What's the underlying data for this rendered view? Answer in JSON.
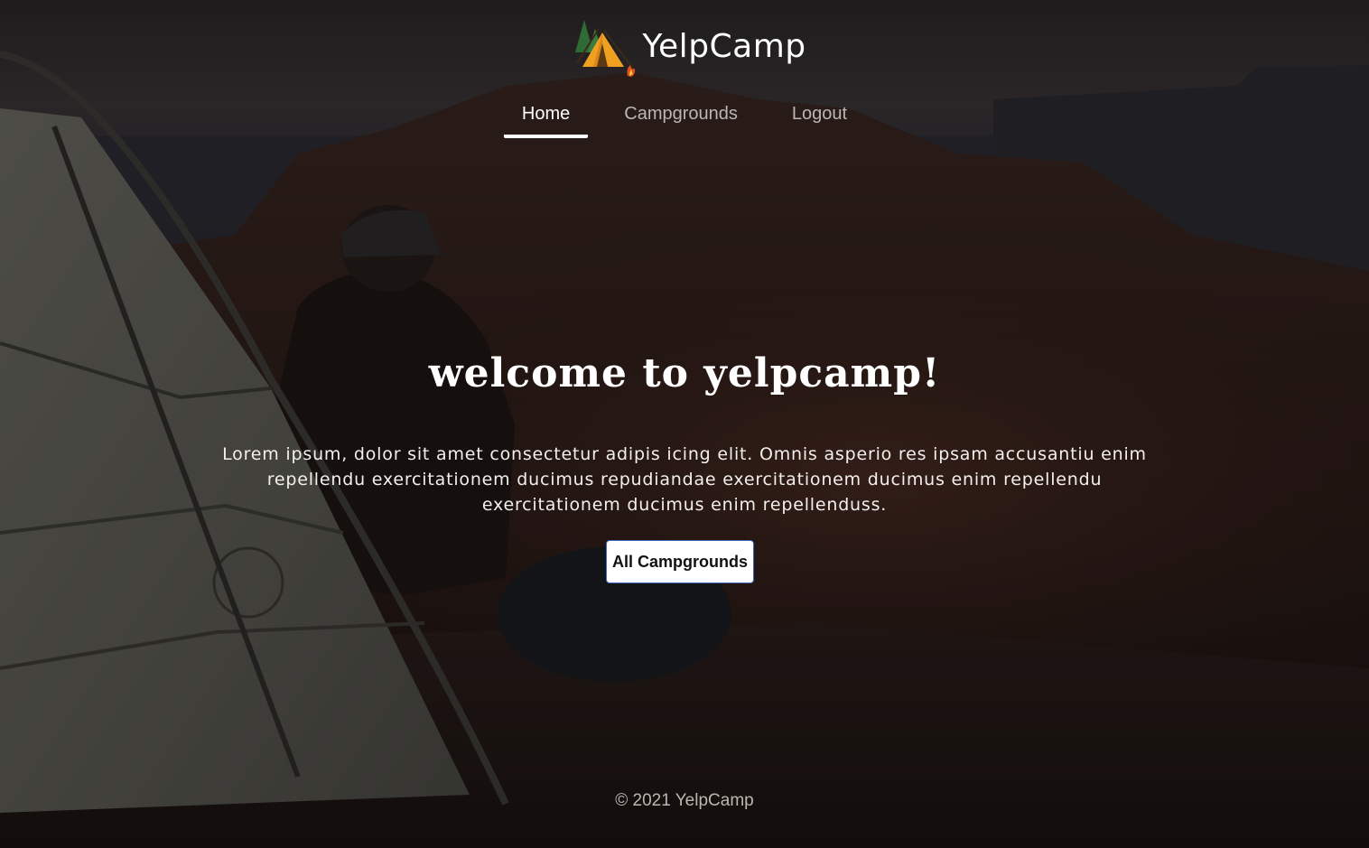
{
  "header": {
    "brand_title": "YelpCamp",
    "logo_icon": "camping-tent-icon"
  },
  "nav": {
    "items": [
      {
        "label": "Home",
        "active": true
      },
      {
        "label": "Campgrounds",
        "active": false
      },
      {
        "label": "Logout",
        "active": false
      }
    ]
  },
  "hero": {
    "title": "welcome to yelpcamp!",
    "description": "Lorem ipsum, dolor sit amet consectetur adipis icing elit. Omnis asperio res ipsam accusantiu enim repellendu exercitationem ducimus repudiandae exercitationem ducimus enim repellendu exercitationem ducimus enim repellenduss.",
    "button_label": "All Campgrounds"
  },
  "footer": {
    "text": "© 2021 YelpCamp"
  },
  "colors": {
    "text_primary": "#ffffff",
    "button_border": "#3b6bb8",
    "background_dark": "#1b1412"
  }
}
